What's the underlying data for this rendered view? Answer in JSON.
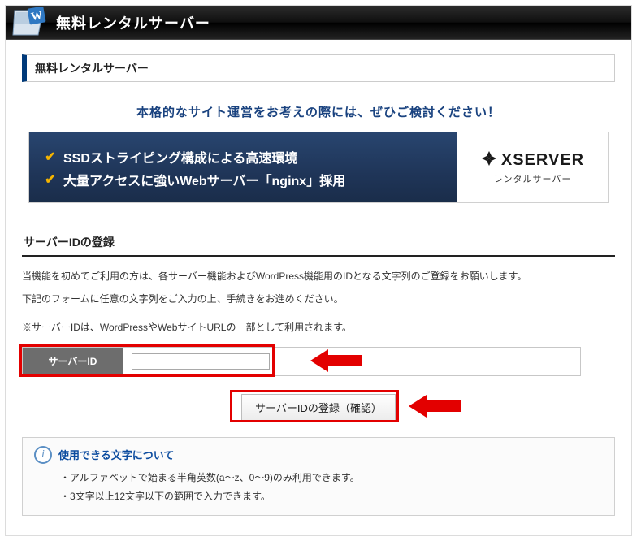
{
  "header": {
    "title": "無料レンタルサーバー"
  },
  "panel": {
    "title": "無料レンタルサーバー"
  },
  "promo": {
    "headline": "本格的なサイト運営をお考えの際には、ぜひご検討ください！",
    "bullets": [
      "SSDストライピング構成による高速環境",
      "大量アクセスに強いWebサーバー「nginx」採用"
    ],
    "brand": "XSERVER",
    "brand_sub": "レンタルサーバー"
  },
  "section": {
    "heading": "サーバーIDの登録",
    "desc_lines": [
      "当機能を初めてご利用の方は、各サーバー機能およびWordPress機能用のIDとなる文字列のご登録をお願いします。",
      "下記のフォームに任意の文字列をご入力の上、手続きをお進めください。"
    ],
    "note": "※サーバーIDは、WordPressやWebサイトURLの一部として利用されます。"
  },
  "form": {
    "label": "サーバーID",
    "value": "",
    "submit_label": "サーバーIDの登録（確認）"
  },
  "info": {
    "title": "使用できる文字について",
    "items": [
      "アルファベットで始まる半角英数(a～z、0～9)のみ利用できます。",
      "3文字以上12文字以下の範囲で入力できます。"
    ]
  }
}
